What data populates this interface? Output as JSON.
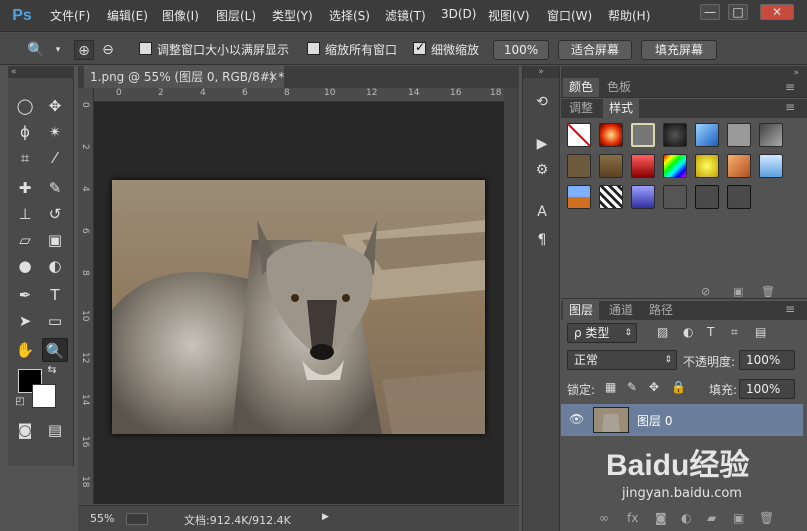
{
  "app": {
    "logo": "Ps"
  },
  "menu": [
    "文件(F)",
    "编辑(E)",
    "图像(I)",
    "图层(L)",
    "类型(Y)",
    "选择(S)",
    "滤镜(T)",
    "3D(D)",
    "视图(V)",
    "窗口(W)",
    "帮助(H)"
  ],
  "window_controls": {
    "minimize": "—",
    "restore": "□",
    "close": "✕"
  },
  "options": {
    "resize_windows_label": "调整窗口大小以满屏显示",
    "resize_windows_checked": false,
    "zoom_all_label": "缩放所有窗口",
    "zoom_all_checked": false,
    "scrubby_label": "细微缩放",
    "scrubby_checked": true,
    "btn_100": "100%",
    "btn_fit": "适合屏幕",
    "btn_fill": "填充屏幕"
  },
  "document_tab": {
    "title": "1.png @ 55% (图层 0, RGB/8#) *",
    "close": "✕"
  },
  "ruler_h": [
    "0",
    "2",
    "4",
    "6",
    "8",
    "10",
    "12",
    "14",
    "16",
    "18"
  ],
  "ruler_v": [
    "0",
    "2",
    "4",
    "6",
    "8",
    "10",
    "12",
    "14",
    "16",
    "18"
  ],
  "status": {
    "zoom": "55%",
    "doc": "文档:912.4K/912.4K",
    "arrow": "▶"
  },
  "panels": {
    "color_tabs": [
      "颜色",
      "色板"
    ],
    "style_tabs": [
      "调整",
      "样式"
    ],
    "layer_tabs": [
      "图层",
      "通道",
      "路径"
    ]
  },
  "layers": {
    "kind_label": "ρ 类型",
    "blend_mode": "正常",
    "opacity_label": "不透明度:",
    "opacity_value": "100%",
    "lock_label": "锁定:",
    "fill_label": "填充:",
    "fill_value": "100%",
    "items": [
      {
        "name": "图层 0",
        "visible": true
      }
    ]
  },
  "watermark": {
    "brand": "Baidu经验",
    "url": "jingyan.baidu.com"
  },
  "colors": {
    "accent": "#4fa3e0",
    "selected_layer": "#6a7e9c",
    "fg": "#000000",
    "bg": "#ffffff"
  }
}
